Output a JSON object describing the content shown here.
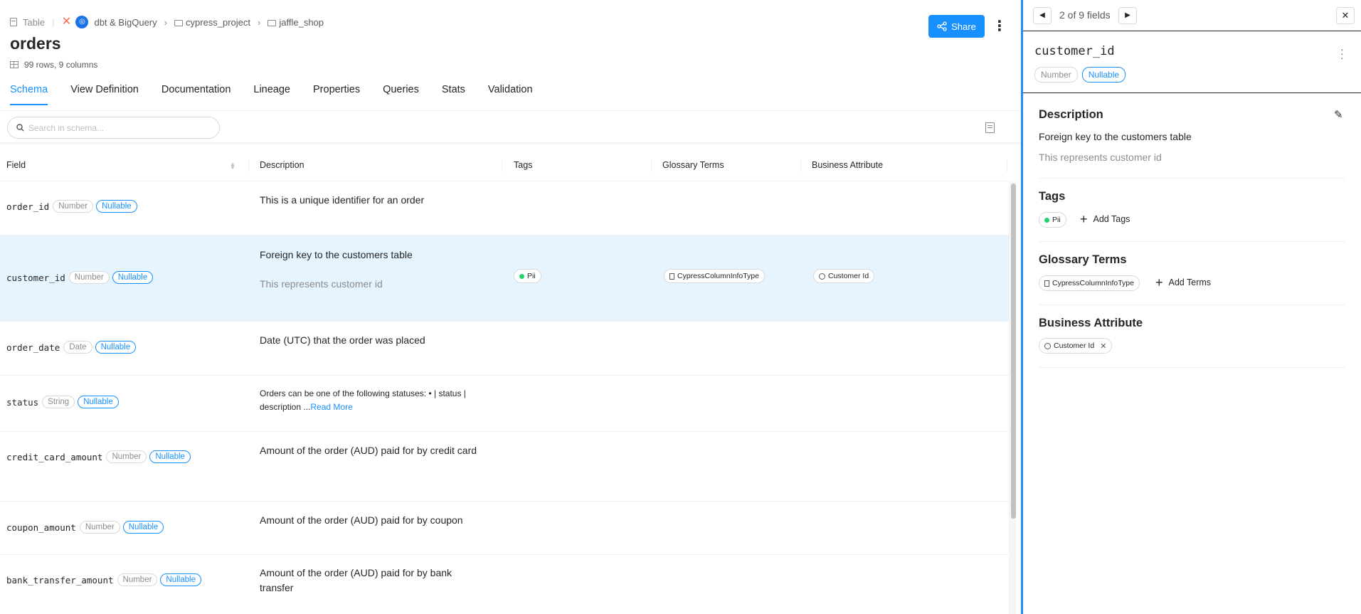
{
  "breadcrumb": {
    "entity_type": "Table",
    "platform": "dbt & BigQuery",
    "project": "cypress_project",
    "dataset": "jaffle_shop"
  },
  "header": {
    "title": "orders",
    "stats": "99 rows, 9 columns",
    "share_label": "Share"
  },
  "tabs": [
    {
      "label": "Schema",
      "active": true
    },
    {
      "label": "View Definition"
    },
    {
      "label": "Documentation"
    },
    {
      "label": "Lineage"
    },
    {
      "label": "Properties"
    },
    {
      "label": "Queries"
    },
    {
      "label": "Stats"
    },
    {
      "label": "Validation"
    }
  ],
  "search": {
    "placeholder": "Search in schema..."
  },
  "columns": [
    "Field",
    "Description",
    "Tags",
    "Glossary Terms",
    "Business Attribute"
  ],
  "rows": [
    {
      "field": "order_id",
      "type": "Number",
      "nullable": "Nullable",
      "description": "This is a unique identifier for an order"
    },
    {
      "field": "customer_id",
      "type": "Number",
      "nullable": "Nullable",
      "description": "Foreign key to the customers table",
      "sub_description": "This represents customer id",
      "tag": "Pii",
      "term": "CypressColumnInfoType",
      "attribute": "Customer Id"
    },
    {
      "field": "order_date",
      "type": "Date",
      "nullable": "Nullable",
      "description": "Date (UTC) that the order was placed"
    },
    {
      "field": "status",
      "type": "String",
      "nullable": "Nullable",
      "description": "Orders can be one of the following statuses: • | status | description ...",
      "read_more": "Read More"
    },
    {
      "field": "credit_card_amount",
      "type": "Number",
      "nullable": "Nullable",
      "description": "Amount of the order (AUD) paid for by credit card"
    },
    {
      "field": "coupon_amount",
      "type": "Number",
      "nullable": "Nullable",
      "description": "Amount of the order (AUD) paid for by coupon"
    },
    {
      "field": "bank_transfer_amount",
      "type": "Number",
      "nullable": "Nullable",
      "description": "Amount of the order (AUD) paid for by bank transfer"
    }
  ],
  "panel": {
    "nav_text": "2 of 9 fields",
    "field": "customer_id",
    "type": "Number",
    "nullable": "Nullable",
    "description_title": "Description",
    "description": "Foreign key to the customers table",
    "sub_description": "This represents customer id",
    "tags_title": "Tags",
    "tag": "Pii",
    "add_tags": "Add Tags",
    "terms_title": "Glossary Terms",
    "term": "CypressColumnInfoType",
    "add_terms": "Add Terms",
    "attribute_title": "Business Attribute",
    "attribute": "Customer Id"
  },
  "colors": {
    "accent": "#1890ff",
    "selected_row": "#e6f4ff",
    "tag_dot": "#21d46b"
  }
}
